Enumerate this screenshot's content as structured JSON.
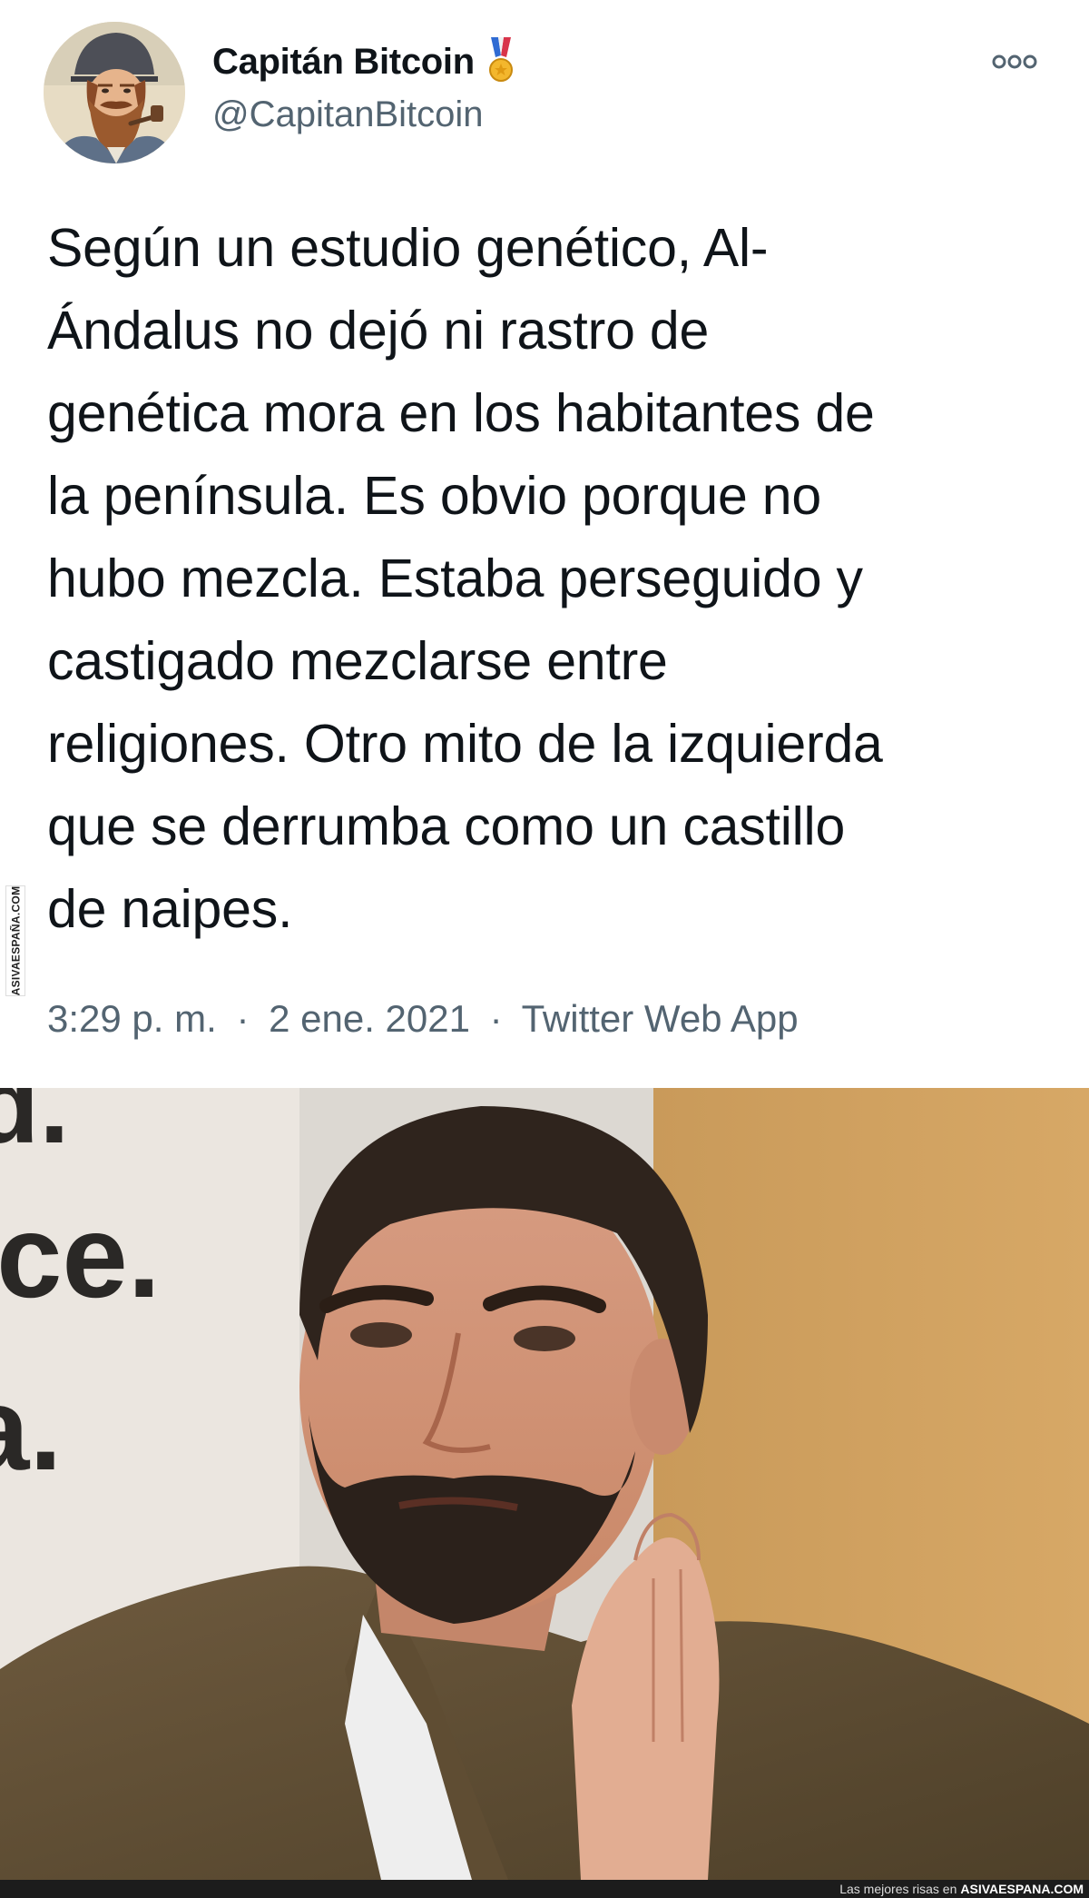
{
  "tweet": {
    "display_name": "Capitán Bitcoin",
    "handle": "@CapitanBitcoin",
    "text": "Según un estudio genético, Al-\nÁndalus no dejó ni rastro de\ngenética mora en los habitantes de\nla península. Es obvio porque no\nhubo mezcla. Estaba perseguido y\ncastigado mezclarse entre\nreligiones. Otro mito de la izquierda\nque se derrumba como un castillo\nde naipes.",
    "time": "3:29 p. m.",
    "date": "2 ene. 2021",
    "separator": "·",
    "source": "Twitter Web App",
    "badge_icon": "medal-icon",
    "more_icon": "more-options-icon"
  },
  "photo": {
    "background_text": [
      "d.",
      "ice.",
      "a."
    ]
  },
  "watermark": {
    "side_text": "ASIVAESPAÑA.COM",
    "footer_prefix": "Las mejores risas en",
    "footer_site": "ASIVAESPANA.COM"
  },
  "colors": {
    "text_primary": "#0f1419",
    "text_secondary": "#536471",
    "footer_bg": "#1c1c1c"
  }
}
